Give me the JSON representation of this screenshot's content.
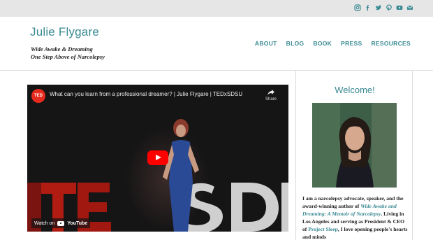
{
  "social": {
    "icons": [
      "instagram-icon",
      "facebook-icon",
      "twitter-icon",
      "pinterest-icon",
      "youtube-icon",
      "email-icon"
    ],
    "color": "#3a8a93"
  },
  "header": {
    "site_title": "Julie Flygare",
    "tagline_line1": "Wide Awake & Dreaming",
    "tagline_line2": "One Step Above of Narcolepsy"
  },
  "nav": {
    "items": [
      "ABOUT",
      "BLOG",
      "BOOK",
      "PRESS",
      "RESOURCES"
    ]
  },
  "video": {
    "channel_logo": "TED",
    "title": "What can you learn from a professional dreamer? | Julie Flygare | TEDxSDSU",
    "share_label": "Share",
    "watch_on_label": "Watch on",
    "youtube_label": "YouTube"
  },
  "sidebar": {
    "heading": "Welcome!",
    "bio_part1": "I am a narcolepsy advocate, speaker, and the award-winning author of ",
    "bio_book": "Wide Awake and Dreaming: A Memoir of Narcolepsy",
    "bio_part2": ". Living in Los Angeles and serving as President & CEO of ",
    "bio_org": "Project Sleep",
    "bio_part3": ", I love opening people's hearts and minds"
  },
  "colors": {
    "accent": "#3a8a93",
    "topbar": "#e6e6e6",
    "youtube_red": "#ff0000",
    "ted_red": "#e62b1e"
  }
}
